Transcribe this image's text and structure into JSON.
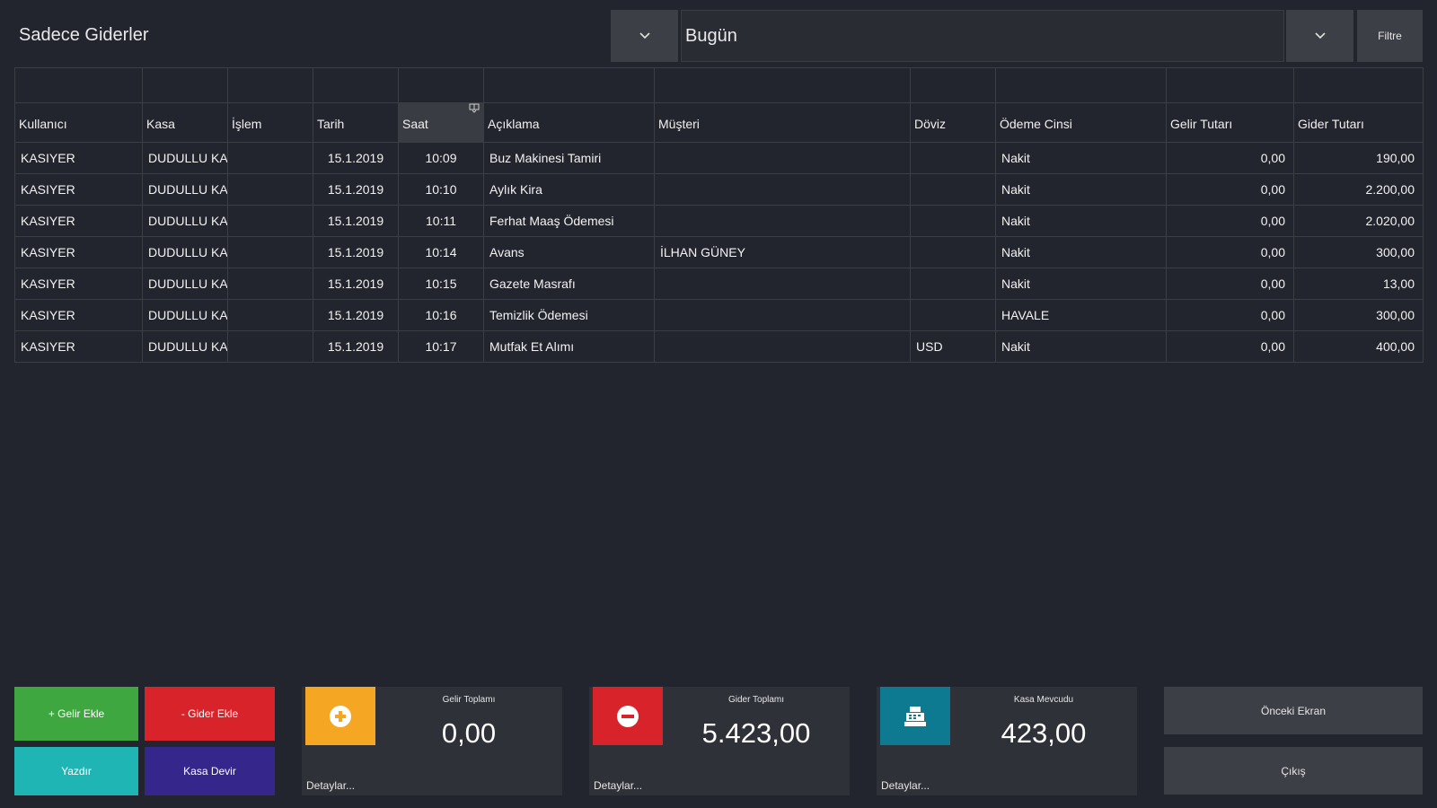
{
  "header": {
    "type_filter": "Sadece Giderler",
    "date_filter": "Bugün",
    "filter_button": "Filtre"
  },
  "table": {
    "columns": [
      "Kullanıcı",
      "Kasa",
      "İşlem",
      "Tarih",
      "Saat",
      "Açıklama",
      "Müşteri",
      "Döviz",
      "Ödeme Cinsi",
      "Gelir Tutarı",
      "Gider Tutarı"
    ],
    "rows": [
      [
        "KASIYER",
        "DUDULLU KASA",
        "",
        "15.1.2019",
        "10:09",
        "Buz Makinesi Tamiri",
        "",
        "",
        "Nakit",
        "0,00",
        "190,00"
      ],
      [
        "KASIYER",
        "DUDULLU KASA",
        "",
        "15.1.2019",
        "10:10",
        "Aylık Kira",
        "",
        "",
        "Nakit",
        "0,00",
        "2.200,00"
      ],
      [
        "KASIYER",
        "DUDULLU KASA",
        "",
        "15.1.2019",
        "10:11",
        "Ferhat Maaş Ödemesi",
        "",
        "",
        "Nakit",
        "0,00",
        "2.020,00"
      ],
      [
        "KASIYER",
        "DUDULLU KASA",
        "",
        "15.1.2019",
        "10:14",
        "Avans",
        "İLHAN GÜNEY",
        "",
        "Nakit",
        "0,00",
        "300,00"
      ],
      [
        "KASIYER",
        "DUDULLU KASA",
        "",
        "15.1.2019",
        "10:15",
        "Gazete Masrafı",
        "",
        "",
        "Nakit",
        "0,00",
        "13,00"
      ],
      [
        "KASIYER",
        "DUDULLU KASA",
        "",
        "15.1.2019",
        "10:16",
        "Temizlik Ödemesi",
        "",
        "",
        "HAVALE",
        "0,00",
        "300,00"
      ],
      [
        "KASIYER",
        "DUDULLU KASA",
        "",
        "15.1.2019",
        "10:17",
        "Mutfak Et Alımı",
        "",
        "USD",
        "Nakit",
        "0,00",
        "400,00"
      ]
    ]
  },
  "actions": {
    "add_income": "+ Gelir Ekle",
    "add_expense": "- Gider Ekle",
    "print": "Yazdır",
    "transfer": "Kasa Devir"
  },
  "cards": {
    "income": {
      "label": "Gelir Toplamı",
      "value": "0,00",
      "details": "Detaylar...",
      "icon": "plus-circle-icon",
      "color": "#f5a623"
    },
    "expense": {
      "label": "Gider Toplamı",
      "value": "5.423,00",
      "details": "Detaylar...",
      "icon": "minus-circle-icon",
      "color": "#d9232a"
    },
    "cash": {
      "label": "Kasa Mevcudu",
      "value": "423,00",
      "details": "Detaylar...",
      "icon": "cash-register-icon",
      "color": "#0e7a92"
    }
  },
  "nav": {
    "previous": "Önceki Ekran",
    "exit": "Çıkış"
  },
  "colors": {
    "green": "#3fa73f",
    "red": "#d9232a",
    "teal": "#20b5b5",
    "indigo": "#34268a"
  }
}
